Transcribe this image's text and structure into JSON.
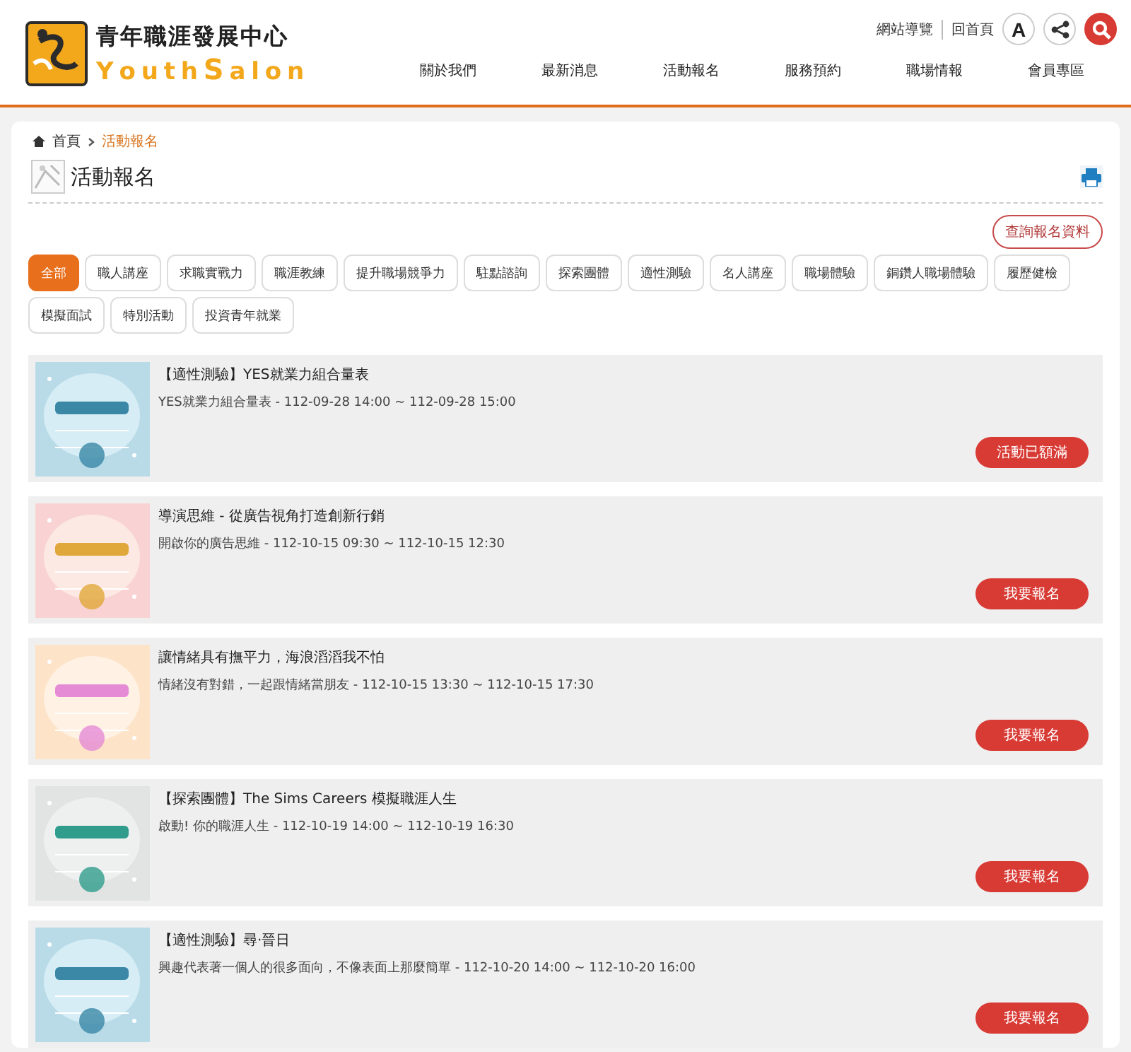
{
  "header": {
    "logo_title": "青年職涯發展中心",
    "logo_sub_1": "Y o u t h",
    "logo_sub_2": "S",
    "logo_sub_3": "a l o n",
    "top_links": [
      "網站導覽",
      "回首頁"
    ],
    "font_button": "A",
    "nav": [
      "關於我們",
      "最新消息",
      "活動報名",
      "服務預約",
      "職場情報",
      "會員專區"
    ]
  },
  "breadcrumb": [
    "首頁",
    "活動報名"
  ],
  "page_title": "活動報名",
  "query_button": "查詢報名資料",
  "tags": [
    {
      "label": "全部",
      "selected": true
    },
    {
      "label": "職人講座",
      "selected": false
    },
    {
      "label": "求職實戰力",
      "selected": false
    },
    {
      "label": "職涯教練",
      "selected": false
    },
    {
      "label": "提升職場競爭力",
      "selected": false
    },
    {
      "label": "駐點諮詢",
      "selected": false
    },
    {
      "label": "探索團體",
      "selected": false
    },
    {
      "label": "適性測驗",
      "selected": false
    },
    {
      "label": "名人講座",
      "selected": false
    },
    {
      "label": "職場體驗",
      "selected": false
    },
    {
      "label": "銅鑽人職場體驗",
      "selected": false
    },
    {
      "label": "履歷健檢",
      "selected": false
    },
    {
      "label": "模擬面試",
      "selected": false
    },
    {
      "label": "特別活動",
      "selected": false
    },
    {
      "label": "投資青年就業",
      "selected": false
    }
  ],
  "events": [
    {
      "title": "【適性測驗】YES就業力組合量表",
      "detail": "YES就業力組合量表 - 112-09-28 14:00 ~ 112-09-28 15:00",
      "button": "活動已額滿"
    },
    {
      "title": "導演思維 - 從廣告視角打造創新行銷",
      "detail": "開啟你的廣告思維 - 112-10-15 09:30 ~ 112-10-15 12:30",
      "button": "我要報名"
    },
    {
      "title": "讓情緒具有撫平力，海浪滔滔我不怕",
      "detail": "情緒沒有對錯，一起跟情緒當朋友 - 112-10-15 13:30 ~ 112-10-15 17:30",
      "button": "我要報名"
    },
    {
      "title": "【探索團體】The Sims Careers 模擬職涯人生",
      "detail": "啟動! 你的職涯人生 - 112-10-19 14:00 ~ 112-10-19 16:30",
      "button": "我要報名"
    },
    {
      "title": "【適性測驗】尋·晉日",
      "detail": "興趣代表著一個人的很多面向，不像表面上那麼簡單 - 112-10-20 14:00 ~ 112-10-20 16:00",
      "button": "我要報名"
    }
  ]
}
